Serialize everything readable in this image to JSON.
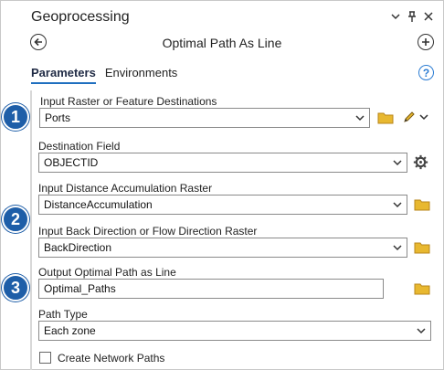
{
  "window": {
    "title": "Geoprocessing"
  },
  "tool": {
    "name": "Optimal Path As Line"
  },
  "tabs": [
    {
      "label": "Parameters",
      "active": true
    },
    {
      "label": "Environments",
      "active": false
    }
  ],
  "params": {
    "input_raster_label": "Input Raster or Feature Destinations",
    "input_raster_value": "Ports",
    "destination_field_label": "Destination Field",
    "destination_field_value": "OBJECTID",
    "distance_accum_label": "Input Distance Accumulation Raster",
    "distance_accum_value": "DistanceAccumulation",
    "back_direction_label": "Input Back Direction or Flow Direction Raster",
    "back_direction_value": "BackDirection",
    "output_label": "Output Optimal Path as Line",
    "output_value": "Optimal_Paths",
    "path_type_label": "Path Type",
    "path_type_value": "Each zone",
    "network_paths_label": "Create Network Paths",
    "network_paths_checked": false
  },
  "badges": [
    "1",
    "2",
    "3"
  ],
  "colors": {
    "badge": "#1e5ea8",
    "accent": "#2b7cd3",
    "folder": "#e8b830"
  }
}
